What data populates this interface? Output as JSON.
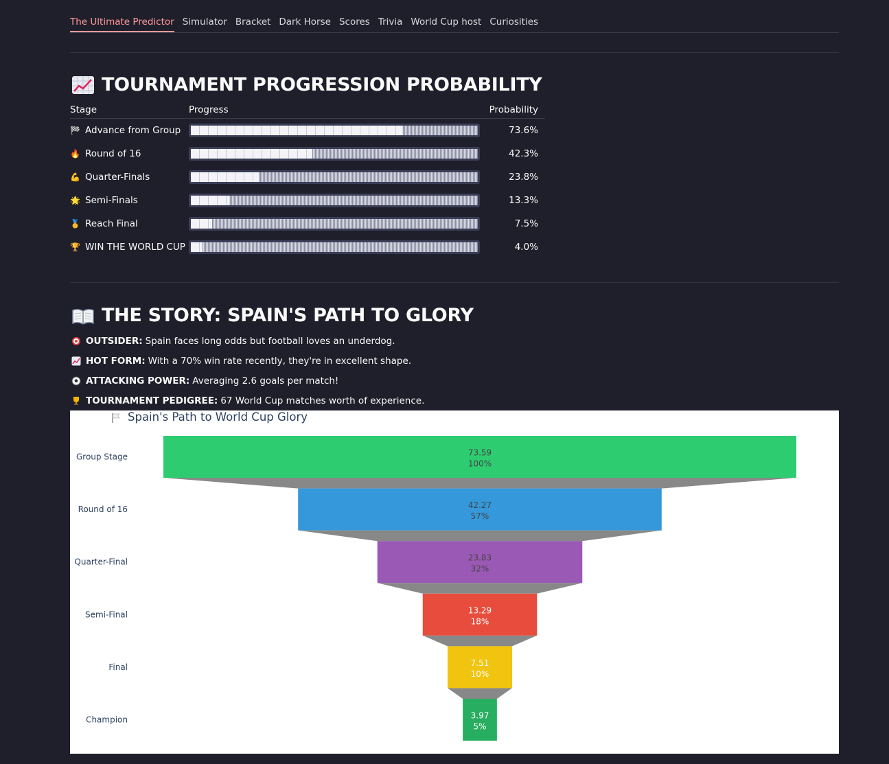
{
  "tabs": [
    "The Ultimate Predictor",
    "Simulator",
    "Bracket",
    "Dark Horse",
    "Scores",
    "Trivia",
    "World Cup host",
    "Curiosities"
  ],
  "progression": {
    "title": "TOURNAMENT PROGRESSION PROBABILITY",
    "icon": "chart-increasing-icon",
    "headers": {
      "stage": "Stage",
      "progress": "Progress",
      "probability": "Probability"
    },
    "rows": [
      {
        "icon": "checkered-flag-icon",
        "stage": "Advance from Group",
        "value": 73.6,
        "label": "73.6%"
      },
      {
        "icon": "fire-icon",
        "stage": "Round of 16",
        "value": 42.3,
        "label": "42.3%"
      },
      {
        "icon": "flexed-biceps-icon",
        "stage": "Quarter-Finals",
        "value": 23.8,
        "label": "23.8%"
      },
      {
        "icon": "glowing-star-icon",
        "stage": "Semi-Finals",
        "value": 13.3,
        "label": "13.3%"
      },
      {
        "icon": "medal-icon",
        "stage": "Reach Final",
        "value": 7.5,
        "label": "7.5%"
      },
      {
        "icon": "trophy-icon",
        "stage": "WIN THE WORLD CUP",
        "value": 4.0,
        "label": "4.0%"
      }
    ]
  },
  "story": {
    "title": "THE STORY: SPAIN'S PATH TO GLORY",
    "icon": "open-book-icon",
    "items": [
      {
        "icon": "target-icon",
        "label": "OUTSIDER:",
        "text": "Spain faces long odds but football loves an underdog."
      },
      {
        "icon": "chart-increasing-icon",
        "label": "HOT FORM:",
        "text": "With a 70% win rate recently, they're in excellent shape."
      },
      {
        "icon": "soccer-ball-icon",
        "label": "ATTACKING POWER:",
        "text": "Averaging 2.6 goals per match!"
      },
      {
        "icon": "trophy-icon",
        "label": "TOURNAMENT PEDIGREE:",
        "text": "67 World Cup matches worth of experience."
      }
    ]
  },
  "chart_data": {
    "type": "funnel",
    "title": "Spain's Path to World Cup Glory",
    "title_icon": "white-flag-icon",
    "categories": [
      "Group Stage",
      "Round of 16",
      "Quarter-Final",
      "Semi-Final",
      "Final",
      "Champion"
    ],
    "values": [
      73.59,
      42.27,
      23.83,
      13.29,
      7.51,
      3.97
    ],
    "percent_labels": [
      "100%",
      "57%",
      "32%",
      "18%",
      "10%",
      "5%"
    ],
    "colors": [
      "#2ecc71",
      "#3498db",
      "#9b59b6",
      "#e74c3c",
      "#f1c40f",
      "#27ae60"
    ],
    "connector_color": "#888888"
  }
}
